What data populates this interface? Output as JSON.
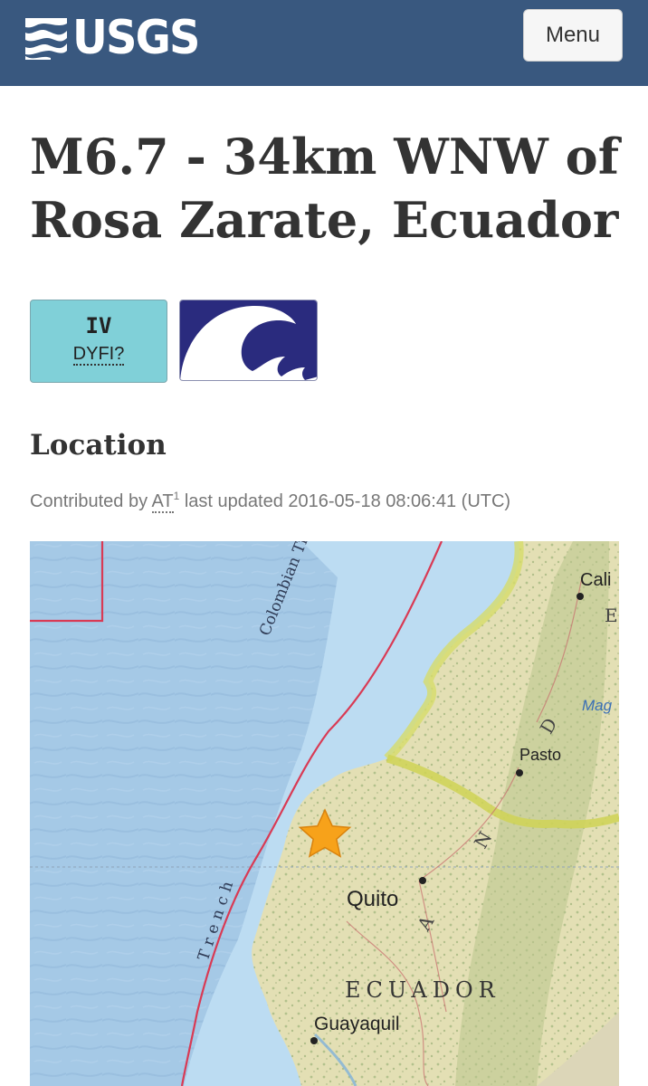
{
  "header": {
    "logo_text": "USGS",
    "menu_label": "Menu",
    "brand_color": "#39587f"
  },
  "event": {
    "title": "M6.7 - 34km WNW of Rosa Zarate, Ecuador"
  },
  "badges": {
    "dyfi": {
      "level": "IV",
      "label": "DYFI?",
      "color": "#80d0d8"
    },
    "tsunami": {
      "icon": "tsunami-wave-icon",
      "color": "#2a2b7e"
    }
  },
  "location": {
    "heading": "Location",
    "contrib_prefix": "Contributed by",
    "contributor": "AT",
    "contributor_sup": "1",
    "contrib_suffix": "last updated 2016-05-18 08:06:41 (UTC)"
  },
  "map": {
    "labels": {
      "trench_1": "Colombian Trench",
      "trench_2": "Trench",
      "cali": "Cali",
      "pasto": "Pasto",
      "quito": "Quito",
      "ecuador": "ECUADOR",
      "guayaquil": "Guayaquil",
      "mag": "Mag",
      "andes_n": "N",
      "andes_d": "D",
      "andes_a": "A",
      "andes_e": "E"
    },
    "epicenter_icon": "star-icon",
    "colors": {
      "ocean": "#a5c9e6",
      "shelf": "#b9dcf2",
      "land": "#e3dfb4",
      "border": "#d93a54"
    }
  }
}
